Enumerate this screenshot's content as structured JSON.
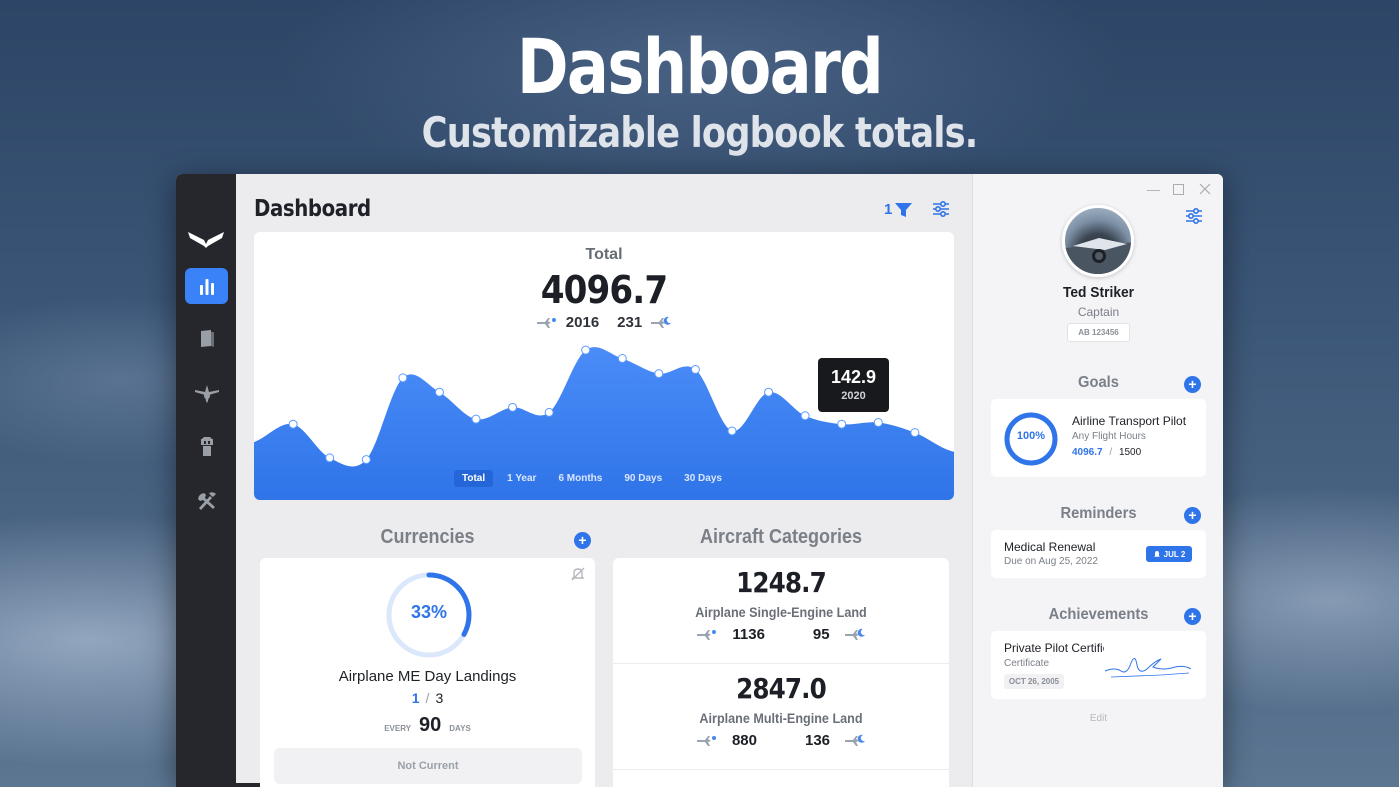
{
  "hero": {
    "title": "Dashboard",
    "subtitle": "Customizable logbook totals."
  },
  "sidebar": {
    "logo_icon": "wing-logo-icon",
    "items": [
      {
        "icon": "bar-chart-icon",
        "active": true
      },
      {
        "icon": "logbook-icon",
        "active": false
      },
      {
        "icon": "airplane-icon",
        "active": false
      },
      {
        "icon": "tower-icon",
        "active": false
      },
      {
        "icon": "tools-icon",
        "active": false
      }
    ]
  },
  "header": {
    "title": "Dashboard",
    "filter_count": "1"
  },
  "total": {
    "label": "Total",
    "value": "4096.7",
    "day": "2016",
    "night": "231",
    "tooltip": {
      "value": "142.9",
      "year": "2020"
    },
    "range_tabs": [
      "Total",
      "1 Year",
      "6 Months",
      "90 Days",
      "30 Days"
    ],
    "active_tab": "Total"
  },
  "chart_data": {
    "type": "area",
    "series": [
      {
        "values": [
          50,
          70,
          90,
          50,
          48,
          145,
          128,
          96,
          110,
          104,
          178,
          168,
          150,
          155,
          82,
          128,
          100,
          90,
          92,
          80,
          58,
          55
        ]
      }
    ],
    "ylim": [
      0,
      190
    ],
    "grid": false,
    "color": "#3a82f7"
  },
  "currencies": {
    "heading": "Currencies",
    "percent": "33%",
    "percent_value": 0.33,
    "name": "Airplane ME Day Landings",
    "current": "1",
    "sep": "/",
    "required": "3",
    "every_label": "EVERY",
    "every_value": "90",
    "days_label": "DAYS",
    "status": "Not Current"
  },
  "aircraft_categories": {
    "heading": "Aircraft Categories",
    "rows": [
      {
        "value": "1248.7",
        "name": "Airplane Single-Engine Land",
        "day": "1136",
        "night": "95"
      },
      {
        "value": "2847.0",
        "name": "Airplane Multi-Engine Land",
        "day": "880",
        "night": "136"
      }
    ]
  },
  "profile": {
    "name": "Ted Striker",
    "rank": "Captain",
    "license": "AB 123456"
  },
  "goals": {
    "heading": "Goals",
    "title": "Airline Transport Pilot",
    "subtitle": "Any Flight Hours",
    "current": "4096.7",
    "sep": "/",
    "target": "1500",
    "percent": "100%"
  },
  "reminders": {
    "heading": "Reminders",
    "title": "Medical Renewal",
    "subtitle": "Due on Aug 25, 2022",
    "badge": "JUL 2"
  },
  "achievements": {
    "heading": "Achievements",
    "title": "Private Pilot Certificate",
    "subtitle": "Certificate",
    "date": "OCT 26, 2005",
    "edit": "Edit"
  },
  "colors": {
    "accent": "#2f74e8",
    "sidebar": "#25272c",
    "chart_fill": "#3a82f7"
  }
}
